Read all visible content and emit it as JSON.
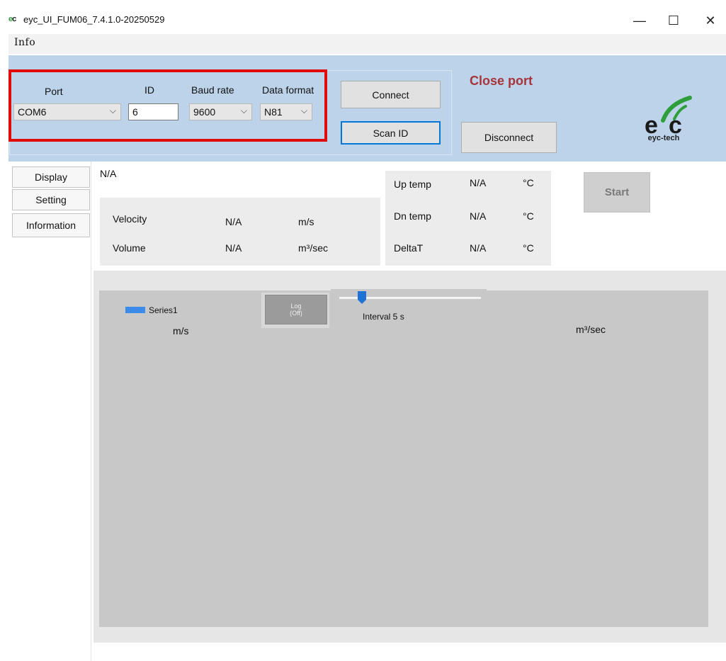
{
  "window": {
    "title": "eyc_UI_FUM06_7.4.1.0-20250529",
    "minimize": "—",
    "maximize": "☐",
    "close": "✕"
  },
  "menu": {
    "info": "Info"
  },
  "connection": {
    "port_label": "Port",
    "port_value": "COM6",
    "id_label": "ID",
    "id_value": "6",
    "baud_label": "Baud rate",
    "baud_value": "9600",
    "format_label": "Data format",
    "format_value": "N81",
    "connect_label": "Connect",
    "scan_label": "Scan ID",
    "disconnect_label": "Disconnect",
    "status": "Close port"
  },
  "logo": {
    "text": "eyc-tech",
    "brand_green": "#2e9e3d"
  },
  "tabs": [
    {
      "label": "Display"
    },
    {
      "label": "Setting"
    },
    {
      "label": "Information"
    }
  ],
  "readouts": {
    "status": "N/A",
    "velocity": {
      "label": "Velocity",
      "value": "N/A",
      "unit": "m/s"
    },
    "volume": {
      "label": "Volume",
      "value": "N/A",
      "unit": "m³/sec"
    },
    "up_temp": {
      "label": "Up temp",
      "value": "N/A",
      "unit": "°C"
    },
    "dn_temp": {
      "label": "Dn temp",
      "value": "N/A",
      "unit": "°C"
    },
    "delta_t": {
      "label": "DeltaT",
      "value": "N/A",
      "unit": "°C"
    }
  },
  "start_label": "Start",
  "chart": {
    "legend": "Series1",
    "unit_left": "m/s",
    "unit_right": "m³/sec",
    "log_line1": "Log",
    "log_line2": "(Off)",
    "interval": "Interval 5 s",
    "series_color": "#3b8ce8"
  }
}
